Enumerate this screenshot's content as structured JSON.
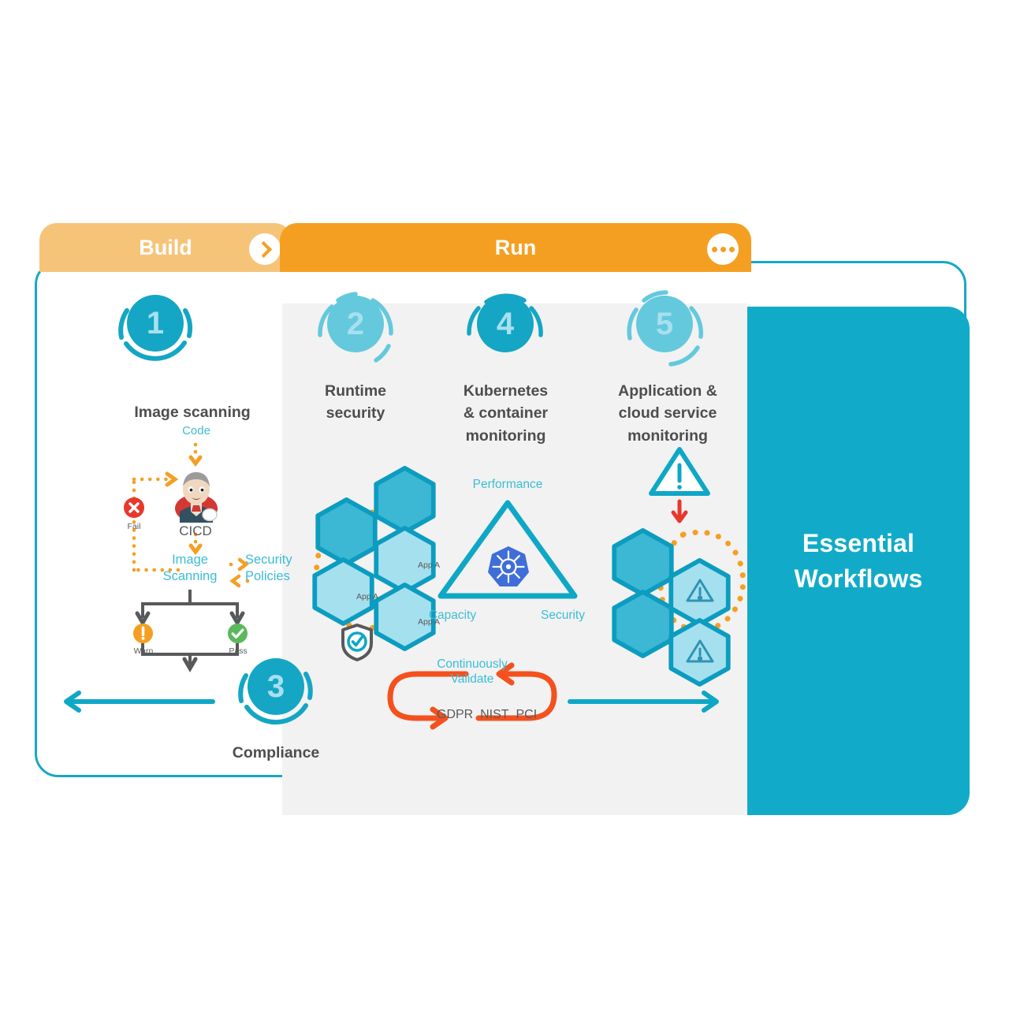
{
  "tabs": {
    "build": {
      "label": "Build",
      "badge_icon": "chevron-right-icon"
    },
    "run": {
      "label": "Run",
      "badge_icon": "ellipsis-icon"
    }
  },
  "right_panel": {
    "title_line1": "Essential",
    "title_line2": "Workflows"
  },
  "steps": [
    {
      "number": "1",
      "title_line1": "Image scanning",
      "title_line2": "",
      "column": "build"
    },
    {
      "number": "2",
      "title_line1": "Runtime",
      "title_line2": "security",
      "column": "run"
    },
    {
      "number": "4",
      "title_line1": "Kubernetes",
      "title_line2": "& container",
      "title_line3": "monitoring",
      "column": "run"
    },
    {
      "number": "5",
      "title_line1": "Application &",
      "title_line2": "cloud service",
      "title_line3": "monitoring",
      "column": "run"
    },
    {
      "number": "3",
      "title_line1": "Compliance",
      "title_line2": "",
      "column": "build"
    }
  ],
  "image_scanning": {
    "code": "Code",
    "cicd": "CICD",
    "image_scanning_l1": "Image",
    "image_scanning_l2": "Scanning",
    "security_policies_l1": "Security",
    "security_policies_l2": "Policies",
    "fail": "Fail",
    "warn": "Warn",
    "pass": "Pass",
    "icons": {
      "fail": "x-circle-icon",
      "warn": "exclamation-circle-icon",
      "pass": "check-circle-icon",
      "cicd": "jenkins-butler-icon"
    }
  },
  "runtime_security": {
    "app_labels": [
      "App A",
      "App A",
      "App A"
    ],
    "shield_icon": "shield-check-icon"
  },
  "kubernetes": {
    "top": "Performance",
    "left": "Capacity",
    "right": "Security",
    "center_icon": "kubernetes-helm-icon"
  },
  "app_cloud": {
    "alert_icon": "warning-triangle-icon",
    "arrow_icon": "down-arrow-icon"
  },
  "compliance": {
    "validate_l1": "Continuously",
    "validate_l2": "Validate",
    "standards": [
      "GDPR",
      "NIST",
      "PCI"
    ]
  },
  "flow_arrows": {
    "left_arrow": "arrow-left-icon",
    "right_arrow": "arrow-right-icon"
  },
  "colors": {
    "teal_dark": "#14a6c4",
    "teal_light": "#64c9dd",
    "teal_pale": "#a8e0ef",
    "orange": "#f59f22",
    "orange_light": "#f6c479",
    "red": "#e8382c",
    "green": "#5cb85c",
    "gray_text": "#58595b",
    "panel_bg": "#f2f2f2",
    "k8s_blue": "#3f6ed8"
  }
}
